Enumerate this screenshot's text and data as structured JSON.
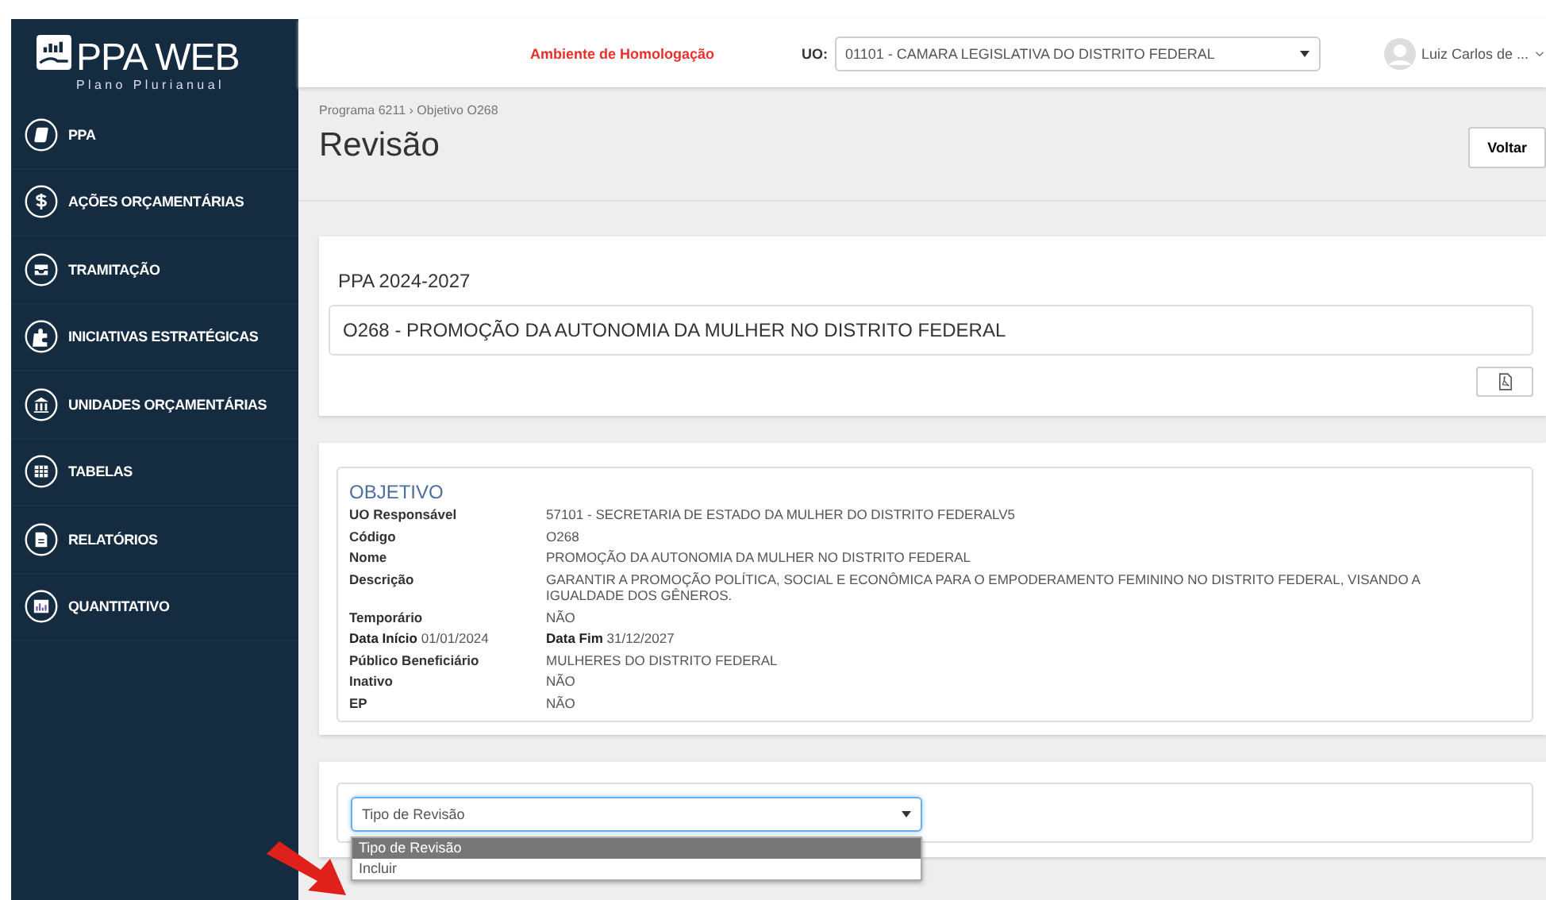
{
  "logo": {
    "title": "PPA WEB",
    "subtitle": "Plano Plurianual"
  },
  "sidebar": {
    "items": [
      {
        "label": "PPA"
      },
      {
        "label": "AÇÕES ORÇAMENTÁRIAS"
      },
      {
        "label": "TRAMITAÇÃO"
      },
      {
        "label": "INICIATIVAS ESTRATÉGICAS"
      },
      {
        "label": "UNIDADES ORÇAMENTÁRIAS"
      },
      {
        "label": "TABELAS"
      },
      {
        "label": "RELATÓRIOS"
      },
      {
        "label": "QUANTITATIVO"
      }
    ]
  },
  "header": {
    "environment": "Ambiente de Homologação",
    "uo_label": "UO:",
    "uo_value": "01101 - CAMARA LEGISLATIVA DO DISTRITO FEDERAL",
    "user": "Luiz Carlos de ..."
  },
  "breadcrumb": "Programa 6211 › Objetivo O268",
  "page_title": "Revisão",
  "back_button": "Voltar",
  "ppa_card": {
    "period": "PPA 2024-2027",
    "objective": "O268 - PROMOÇÃO DA AUTONOMIA DA MULHER NO DISTRITO FEDERAL"
  },
  "details": {
    "heading": "OBJETIVO",
    "rows": [
      {
        "kind": "field",
        "label": "UO Responsável",
        "value": "57101 - SECRETARIA DE ESTADO DA MULHER DO DISTRITO FEDERALV5"
      },
      {
        "kind": "field",
        "label": "Código",
        "value": "O268"
      },
      {
        "kind": "field",
        "label": "Nome",
        "value": "PROMOÇÃO DA AUTONOMIA DA MULHER NO DISTRITO FEDERAL"
      },
      {
        "kind": "field",
        "label": "Descrição",
        "value": "GARANTIR A PROMOÇÃO POLÍTICA, SOCIAL E ECONÔMICA PARA O EMPODERAMENTO FEMININO NO DISTRITO FEDERAL, VISANDO A IGUALDADE DOS GÊNEROS."
      },
      {
        "kind": "field",
        "label": "Temporário",
        "value": "NÃO"
      },
      {
        "kind": "dates",
        "label": "**Data Início** 01/01/2024",
        "value": "**Data Fim** 31/12/2027"
      },
      {
        "kind": "field",
        "label": "Público Beneficiário",
        "value": "MULHERES DO DISTRITO FEDERAL"
      },
      {
        "kind": "field",
        "label": "Inativo",
        "value": "NÃO"
      },
      {
        "kind": "field",
        "label": "EP",
        "value": "NÃO"
      }
    ]
  },
  "revision": {
    "select_value": "Tipo de Revisão",
    "expanded": true,
    "options": [
      {
        "label": "Tipo de Revisão",
        "selected": true
      },
      {
        "label": "Incluir",
        "selected": false
      }
    ]
  }
}
